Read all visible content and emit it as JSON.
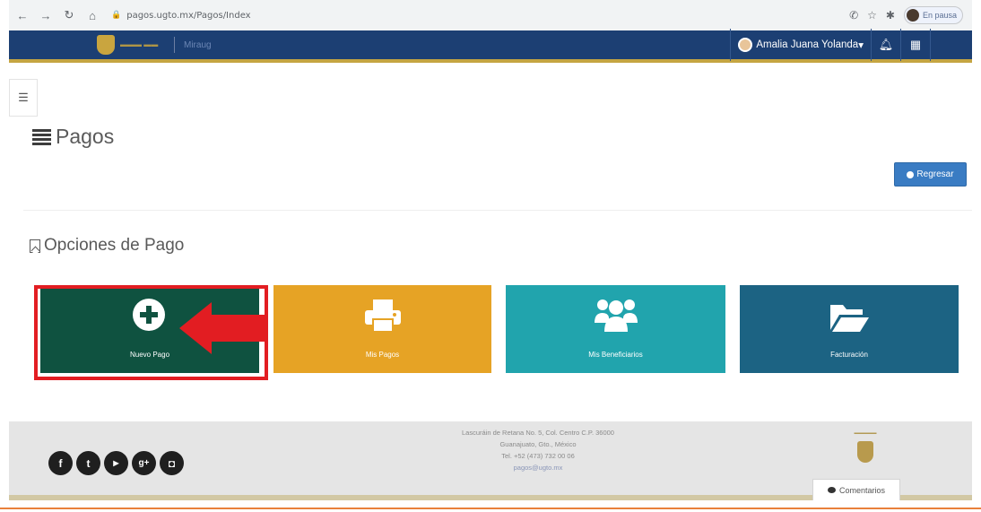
{
  "browser": {
    "url": "pagos.ugto.mx/Pagos/Index",
    "pause_label": "En pausa"
  },
  "header": {
    "app_name": "Miraug",
    "user_name": "Amalia Juana Yolanda",
    "user_caret": "▾"
  },
  "page": {
    "title": "Pagos",
    "back_button": "Regresar",
    "section_title": "Opciones de Pago"
  },
  "tiles": [
    {
      "label": "Nuevo Pago",
      "color": "#0f5240",
      "icon": "plus-circle-icon"
    },
    {
      "label": "Mis Pagos",
      "color": "#e6a325",
      "icon": "printer-icon"
    },
    {
      "label": "Mis Beneficiarios",
      "color": "#21a4ad",
      "icon": "users-icon"
    },
    {
      "label": "Facturación",
      "color": "#1c6383",
      "icon": "folder-open-icon"
    }
  ],
  "annotation": {
    "highlight_color": "#e21d22",
    "arrow_target": "Nuevo Pago"
  },
  "footer": {
    "address_line1": "Lascuráin de Retana No. 5, Col. Centro C.P. 36000",
    "address_line2": "Guanajuato, Gto., México",
    "phone": "Tel. +52 (473) 732 00 06",
    "email": "pagos@ugto.mx",
    "comment_tab": "Comentarios",
    "social": [
      "facebook-icon",
      "twitter-icon",
      "youtube-icon",
      "googleplus-icon",
      "instagram-icon"
    ]
  }
}
